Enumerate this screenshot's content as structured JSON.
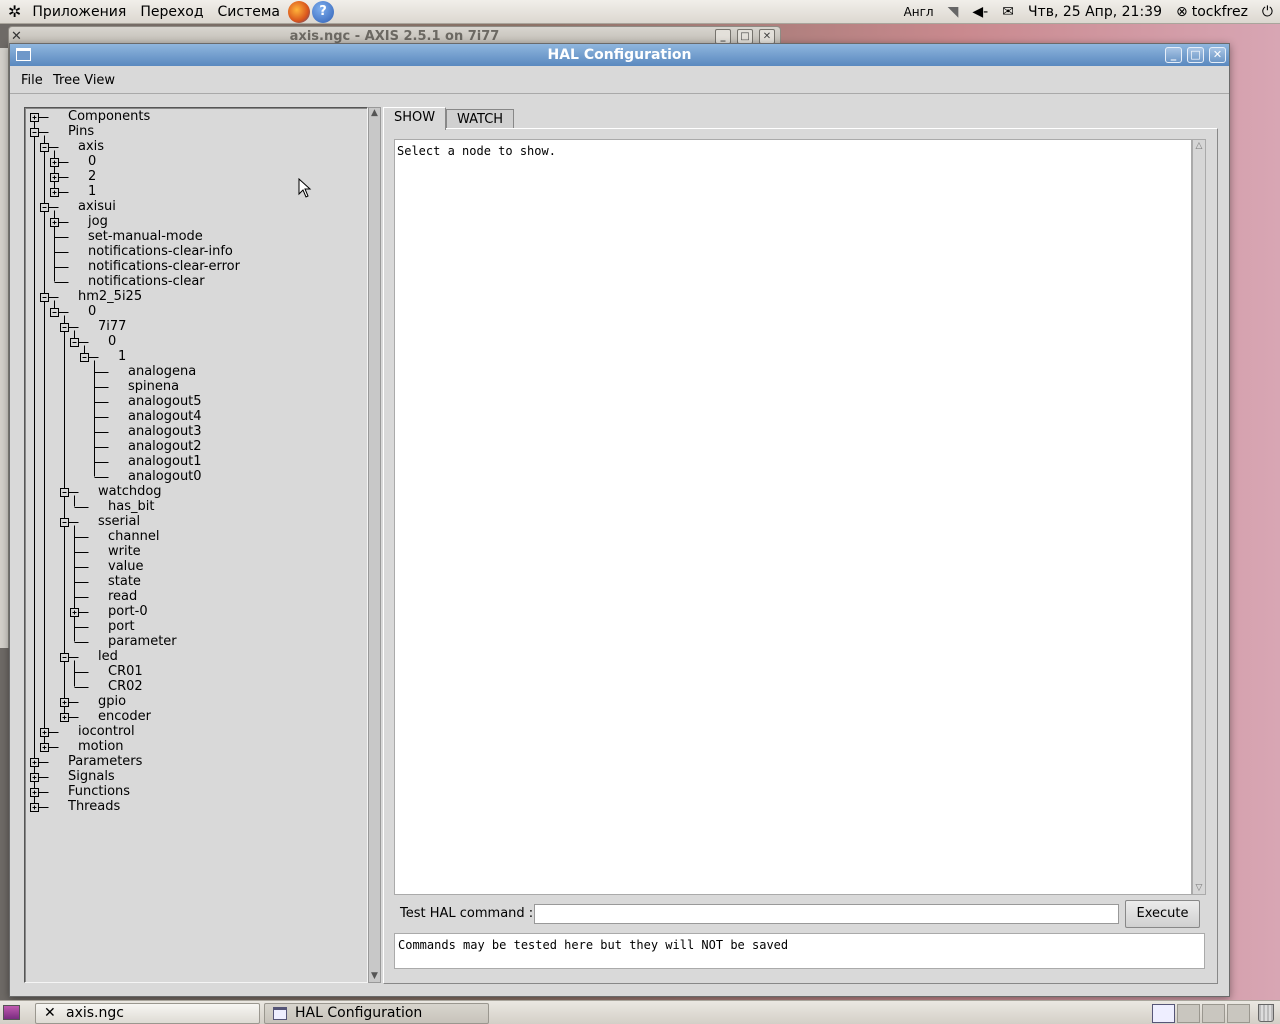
{
  "top_panel": {
    "menu": [
      "Приложения",
      "Переход",
      "Система"
    ],
    "keyboard_layout": "Англ",
    "datetime": "Чтв, 25 Апр, 21:39",
    "user": "tockfrez"
  },
  "background_window": {
    "title": "axis.ngc - AXIS 2.5.1 on 7i77"
  },
  "window": {
    "title": "HAL Configuration"
  },
  "menubar": {
    "items": [
      "File",
      "Tree View"
    ]
  },
  "tree": {
    "nodes": [
      {
        "label": "Components",
        "depth": 0,
        "expander": "plus"
      },
      {
        "label": "Pins",
        "depth": 0,
        "expander": "minus"
      },
      {
        "label": "axis",
        "depth": 1,
        "expander": "minus"
      },
      {
        "label": "0",
        "depth": 2,
        "expander": "plus"
      },
      {
        "label": "2",
        "depth": 2,
        "expander": "plus"
      },
      {
        "label": "1",
        "depth": 2,
        "expander": "plus"
      },
      {
        "label": "axisui",
        "depth": 1,
        "expander": "minus"
      },
      {
        "label": "jog",
        "depth": 2,
        "expander": "plus"
      },
      {
        "label": "set-manual-mode",
        "depth": 2,
        "expander": "none"
      },
      {
        "label": "notifications-clear-info",
        "depth": 2,
        "expander": "none"
      },
      {
        "label": "notifications-clear-error",
        "depth": 2,
        "expander": "none"
      },
      {
        "label": "notifications-clear",
        "depth": 2,
        "expander": "none"
      },
      {
        "label": "hm2_5i25",
        "depth": 1,
        "expander": "minus"
      },
      {
        "label": "0",
        "depth": 2,
        "expander": "minus"
      },
      {
        "label": "7i77",
        "depth": 3,
        "expander": "minus"
      },
      {
        "label": "0",
        "depth": 4,
        "expander": "minus"
      },
      {
        "label": "1",
        "depth": 5,
        "expander": "minus"
      },
      {
        "label": "analogena",
        "depth": 6,
        "expander": "none"
      },
      {
        "label": "spinena",
        "depth": 6,
        "expander": "none"
      },
      {
        "label": "analogout5",
        "depth": 6,
        "expander": "none"
      },
      {
        "label": "analogout4",
        "depth": 6,
        "expander": "none"
      },
      {
        "label": "analogout3",
        "depth": 6,
        "expander": "none"
      },
      {
        "label": "analogout2",
        "depth": 6,
        "expander": "none"
      },
      {
        "label": "analogout1",
        "depth": 6,
        "expander": "none"
      },
      {
        "label": "analogout0",
        "depth": 6,
        "expander": "none"
      },
      {
        "label": "watchdog",
        "depth": 3,
        "expander": "minus"
      },
      {
        "label": "has_bit",
        "depth": 4,
        "expander": "none"
      },
      {
        "label": "sserial",
        "depth": 3,
        "expander": "minus"
      },
      {
        "label": "channel",
        "depth": 4,
        "expander": "none"
      },
      {
        "label": "write",
        "depth": 4,
        "expander": "none"
      },
      {
        "label": "value",
        "depth": 4,
        "expander": "none"
      },
      {
        "label": "state",
        "depth": 4,
        "expander": "none"
      },
      {
        "label": "read",
        "depth": 4,
        "expander": "none"
      },
      {
        "label": "port-0",
        "depth": 4,
        "expander": "plus"
      },
      {
        "label": "port",
        "depth": 4,
        "expander": "none"
      },
      {
        "label": "parameter",
        "depth": 4,
        "expander": "none"
      },
      {
        "label": "led",
        "depth": 3,
        "expander": "minus"
      },
      {
        "label": "CR01",
        "depth": 4,
        "expander": "none"
      },
      {
        "label": "CR02",
        "depth": 4,
        "expander": "none"
      },
      {
        "label": "gpio",
        "depth": 3,
        "expander": "plus"
      },
      {
        "label": "encoder",
        "depth": 3,
        "expander": "plus"
      },
      {
        "label": "iocontrol",
        "depth": 1,
        "expander": "plus"
      },
      {
        "label": "motion",
        "depth": 1,
        "expander": "plus"
      },
      {
        "label": "Parameters",
        "depth": 0,
        "expander": "plus"
      },
      {
        "label": "Signals",
        "depth": 0,
        "expander": "plus"
      },
      {
        "label": "Functions",
        "depth": 0,
        "expander": "plus"
      },
      {
        "label": "Threads",
        "depth": 0,
        "expander": "plus"
      }
    ]
  },
  "tabs": {
    "show": "SHOW",
    "watch": "WATCH",
    "active": "SHOW"
  },
  "show_panel": {
    "text": "Select a node to show."
  },
  "command": {
    "label": "Test HAL command :",
    "value": "",
    "execute": "Execute"
  },
  "output": {
    "text": "Commands may be tested here but they will NOT be saved"
  },
  "taskbar": {
    "tasks": [
      "axis.ngc",
      "HAL Configuration"
    ]
  },
  "colors": {
    "titlebar": "#6f98c9",
    "panel_bg": "#d9d9d9"
  }
}
